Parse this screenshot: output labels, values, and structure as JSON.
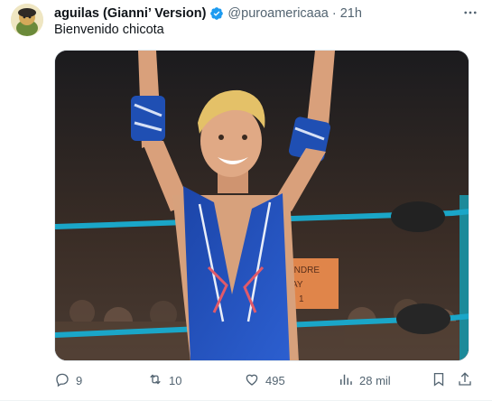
{
  "author": {
    "display_name": "aguilas (Gianni’ Version)",
    "handle": "@puroamericaaa",
    "separator": "·",
    "time": "21h"
  },
  "tweet": {
    "text": "Bienvenido chicota"
  },
  "media": {
    "sign_text_line1": "ANDRE",
    "sign_text_line2": "AY",
    "sign_text_line3": "1"
  },
  "actions": {
    "replies": "9",
    "retweets": "10",
    "likes": "495",
    "views": "28 mil"
  },
  "colors": {
    "text_primary": "#0f1419",
    "text_secondary": "#536471",
    "verified_blue": "#1d9bf0"
  },
  "icons": [
    "more-icon",
    "verified-badge-icon",
    "reply-icon",
    "retweet-icon",
    "like-icon",
    "views-icon",
    "bookmark-icon",
    "share-icon"
  ]
}
